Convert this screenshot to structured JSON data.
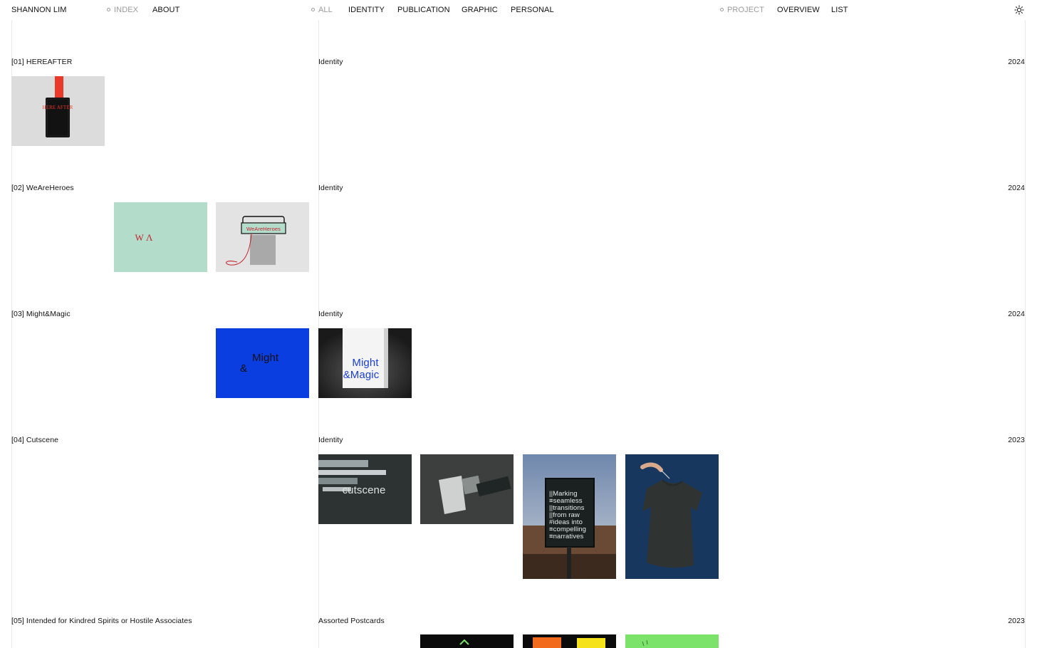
{
  "site": {
    "name": "SHANNON LIM"
  },
  "nav": {
    "index": "INDEX",
    "about": "ABOUT",
    "all": "ALL",
    "identity": "IDENTITY",
    "publication": "PUBLICATION",
    "graphic": "GRAPHIC",
    "personal": "PERSONAL",
    "project": "PROJECT",
    "overview": "OVERVIEW",
    "list": "LIST",
    "theme_icon": "sun-icon"
  },
  "projects": [
    {
      "title": "[01] HEREAFTER",
      "category": "Identity",
      "year": "2024",
      "thumb_texts": [
        "HERE AFTER"
      ]
    },
    {
      "title": "[02] WeAreHeroes",
      "category": "Identity",
      "year": "2024",
      "thumb_texts": [
        "W Λ",
        "WeAreHeroes"
      ]
    },
    {
      "title": "[03] Might&Magic",
      "category": "Identity",
      "year": "2024",
      "thumb_texts": [
        "Might",
        "&",
        "Might",
        "&Magic"
      ]
    },
    {
      "title": "[04] Cutscene",
      "category": "Identity",
      "year": "2023",
      "thumb_texts": [
        "cutscene",
        "||Marking",
        "≡seamless",
        "||transitions",
        "||from raw",
        "#ideas into",
        "≡compelling",
        "≡narratives"
      ]
    },
    {
      "title": "[05] Intended for Kindred Spirits or Hostile Associates",
      "category": "Assorted Postcards",
      "year": "2023",
      "thumb_texts": []
    }
  ],
  "colors": {
    "accent_red": "#e8392a",
    "mint": "#b3dccb",
    "blue": "#0a3ee0",
    "dark_slate": "#2c3332",
    "navy": "#17375f",
    "green": "#7be36a",
    "orange": "#f26a1b",
    "yellow": "#f5e21a"
  }
}
